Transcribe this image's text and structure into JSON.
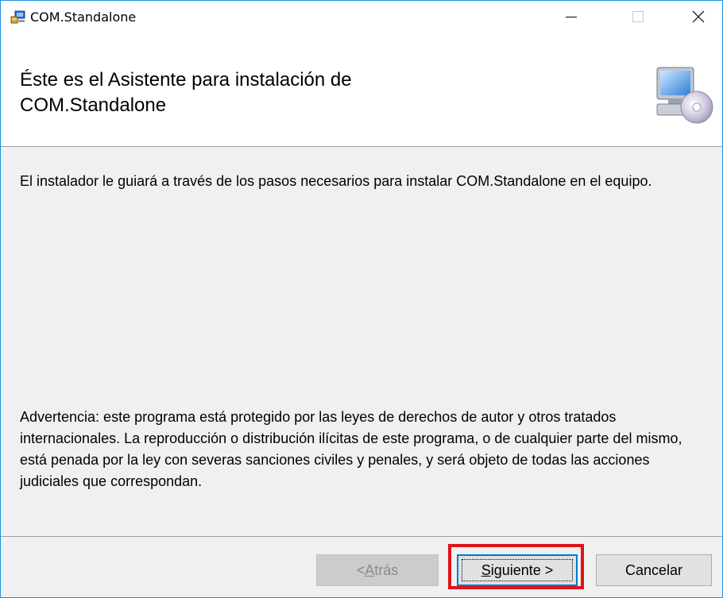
{
  "window": {
    "title": "COM.Standalone",
    "controls": {
      "minimize": "minimize-icon",
      "maximize": "maximize-icon",
      "close": "close-icon"
    }
  },
  "header": {
    "title_line1": "Éste es el Asistente para instalación de",
    "title_line2": "COM.Standalone",
    "icon": "computer-cd-icon"
  },
  "content": {
    "intro": "El instalador le guiará a través de los pasos necesarios para instalar COM.Standalone en el equipo.",
    "warning": "Advertencia: este programa está protegido por las leyes de derechos de autor y otros tratados internacionales. La reproducción o distribución ilícitas de este programa, o de cualquier parte del mismo, está penada por la ley con severas sanciones civiles y penales, y será objeto de todas las acciones judiciales que correspondan."
  },
  "buttons": {
    "back_prefix": "< ",
    "back_accel": "A",
    "back_rest": "trás",
    "next_accel": "S",
    "next_rest": "iguiente >",
    "cancel": "Cancelar"
  },
  "colors": {
    "highlight": "#e0121c",
    "focus_border": "#0078d7",
    "window_border": "#1e90e6"
  }
}
